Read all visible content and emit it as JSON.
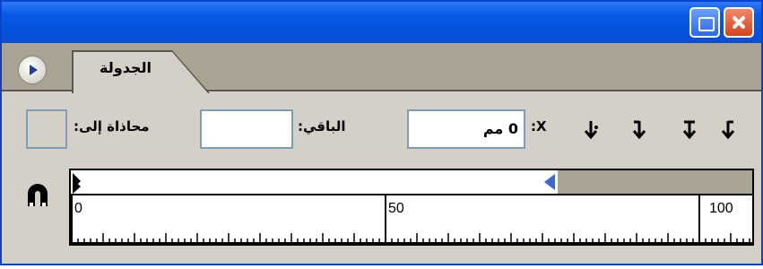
{
  "window": {
    "minimize_icon": "restore-icon",
    "close_icon": "close-icon",
    "colors": {
      "titlebar": "#0552dc",
      "close": "#d4421e"
    }
  },
  "tabs": {
    "active_label": "الجدولة",
    "nav_icon": "play-arrow-icon"
  },
  "controls": {
    "x_label": "X:",
    "x_value": "0 مم",
    "gap_label": "الباقي:",
    "gap_value": "",
    "align_label": "محاذاة إلى:",
    "align_value": "",
    "tab_buttons": [
      {
        "name": "left-justified-tab-icon"
      },
      {
        "name": "center-justified-tab-icon"
      },
      {
        "name": "right-justified-tab-icon"
      },
      {
        "name": "align-to-decimal-tab-icon"
      }
    ]
  },
  "ruler": {
    "icon": "magnet-icon",
    "labels": [
      "0",
      "50",
      "100"
    ]
  }
}
